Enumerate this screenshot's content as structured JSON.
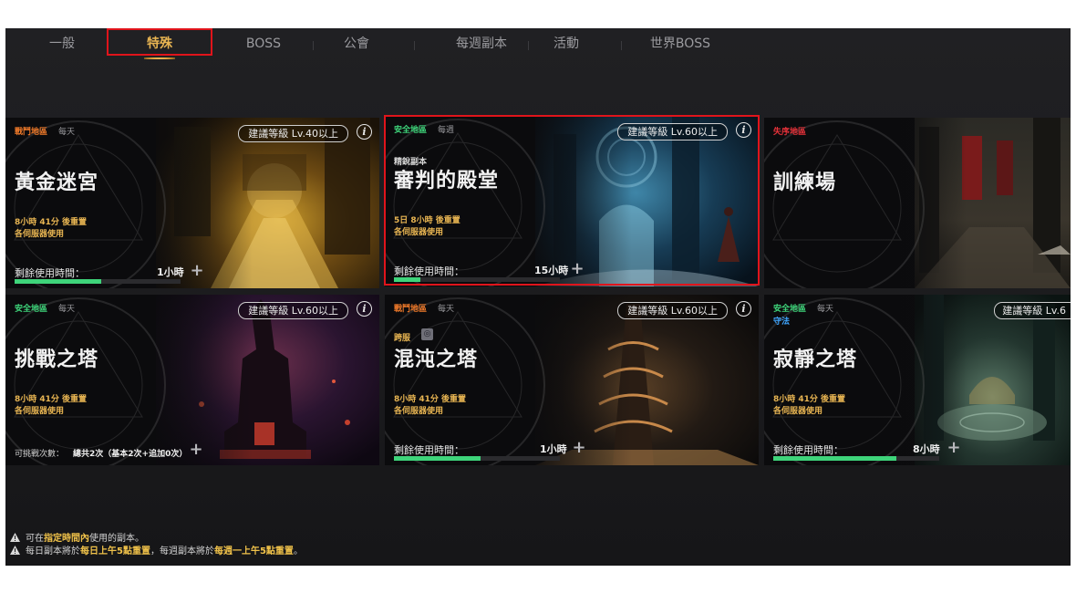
{
  "tabs": [
    {
      "label": "一般",
      "active": false
    },
    {
      "label": "特殊",
      "active": true
    },
    {
      "label": "BOSS",
      "active": false
    },
    {
      "label": "公會",
      "active": false
    },
    {
      "label": "每週副本",
      "active": false
    },
    {
      "label": "活動",
      "active": false
    },
    {
      "label": "世界BOSS",
      "active": false
    }
  ],
  "colors": {
    "safe_zone": "#3ed47a",
    "battle_zone": "#f07a2a",
    "chaos_zone": "#e8323a",
    "reset_text": "#e8b552",
    "progress": "#3ed47a",
    "highlight": "#e0141b",
    "cross_server": "#e8b552",
    "guard": "#3fa6ff"
  },
  "cards": [
    {
      "zone": "戰鬥地區",
      "zone_type": "battle",
      "frequency": "每天",
      "title": "黃金迷宮",
      "level": "建議等級 Lv.40以上",
      "reset": "8小時 41分 後重置",
      "server": "各伺服器使用",
      "remain_label": "剩餘使用時間：",
      "remain_value": "1小時",
      "remain_fraction": 0.52
    },
    {
      "zone": "安全地區",
      "zone_type": "safe",
      "frequency": "每週",
      "subtitle": "精銳副本",
      "title": "審判的殿堂",
      "level": "建議等級 Lv.60以上",
      "reset": "5日 8小時 後重置",
      "server": "各伺服器使用",
      "remain_label": "剩餘使用時間：",
      "remain_value": "15小時",
      "remain_fraction": 0.16
    },
    {
      "zone": "失序地區",
      "zone_type": "chaos",
      "title": "訓練場"
    },
    {
      "zone": "安全地區",
      "zone_type": "safe",
      "frequency": "每天",
      "title": "挑戰之塔",
      "level": "建議等級 Lv.60以上",
      "reset": "8小時 41分 後重置",
      "server": "各伺服器使用",
      "attempts_label": "可挑戰次數：",
      "attempts_value": "總共2次（基本2次+追加0次）"
    },
    {
      "zone": "戰鬥地區",
      "zone_type": "battle",
      "frequency": "每天",
      "tag": "跨服",
      "title": "混沌之塔",
      "level": "建議等級 Lv.60以上",
      "reset": "8小時 41分 後重置",
      "server": "各伺服器使用",
      "remain_label": "剩餘使用時間：",
      "remain_value": "1小時",
      "remain_fraction": 0.52
    },
    {
      "zone": "安全地區",
      "zone_type": "safe",
      "frequency": "每天",
      "tag": "守法",
      "title": "寂靜之塔",
      "level": "建議等級 Lv.6",
      "reset": "8小時 41分 後重置",
      "server": "各伺服器使用",
      "remain_label": "剩餘使用時間：",
      "remain_value": "8小時",
      "remain_fraction": 0.74
    }
  ],
  "notes": {
    "line1_a": "可在",
    "line1_b": "指定時間內",
    "line1_c": "使用的副本。",
    "line2_a": "每日副本將於",
    "line2_b": "每日上午5點重置",
    "line2_c": "，每週副本將於",
    "line2_d": "每週一上午5點重置",
    "line2_e": "。"
  }
}
